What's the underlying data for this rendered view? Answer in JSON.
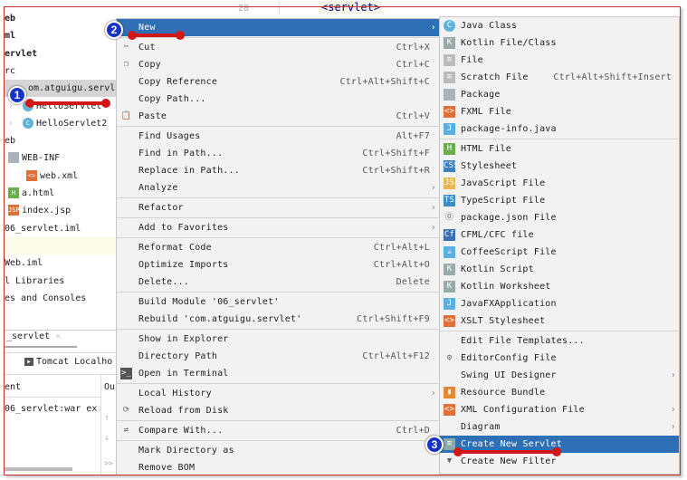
{
  "left_panel": {
    "tree": [
      {
        "label": "eb",
        "bold": true
      },
      {
        "label": "ml",
        "bold": true
      },
      {
        "label": "ervlet",
        "bold": true
      },
      {
        "label": "rc"
      },
      {
        "label": "om.atguigu.servl",
        "selected": true
      },
      {
        "label": "HelloServlet",
        "icon": "class-icon"
      },
      {
        "label": "HelloServlet2",
        "icon": "class-icon"
      },
      {
        "label": "eb"
      },
      {
        "label": "WEB-INF",
        "icon": "folder-icon"
      },
      {
        "label": "web.xml",
        "icon": "xml-file-icon"
      },
      {
        "label": "a.html",
        "icon": "html-file-icon"
      },
      {
        "label": "index.jsp",
        "icon": "jsp-file-icon"
      },
      {
        "label": "06_servlet.iml"
      },
      {
        "label": ""
      },
      {
        "label": "Web.iml"
      },
      {
        "label": "l Libraries"
      },
      {
        "label": "es and Consoles"
      }
    ],
    "run_tab": "_servlet",
    "tomcat_label": "Tomcat Localho",
    "col_header": "ent",
    "col_header2": "Ou",
    "deploy_item": "06_servlet:war ex",
    "more": ">>"
  },
  "editor": {
    "line_number": "28",
    "code": "<servlet>"
  },
  "context_menu": {
    "groups": [
      [
        {
          "label": "New",
          "arrow": true,
          "highlight": true
        }
      ],
      [
        {
          "label": "Cut",
          "shortcut": "Ctrl+X",
          "icon": "cut-icon"
        },
        {
          "label": "Copy",
          "shortcut": "Ctrl+C",
          "icon": "copy-icon"
        },
        {
          "label": "Copy Reference",
          "shortcut": "Ctrl+Alt+Shift+C"
        },
        {
          "label": "Copy Path...",
          "shortcut": ""
        },
        {
          "label": "Paste",
          "shortcut": "Ctrl+V",
          "icon": "paste-icon"
        }
      ],
      [
        {
          "label": "Find Usages",
          "shortcut": "Alt+F7"
        },
        {
          "label": "Find in Path...",
          "shortcut": "Ctrl+Shift+F"
        },
        {
          "label": "Replace in Path...",
          "shortcut": "Ctrl+Shift+R"
        },
        {
          "label": "Analyze",
          "arrow": true
        }
      ],
      [
        {
          "label": "Refactor",
          "arrow": true
        }
      ],
      [
        {
          "label": "Add to Favorites",
          "arrow": true
        }
      ],
      [
        {
          "label": "Reformat Code",
          "shortcut": "Ctrl+Alt+L"
        },
        {
          "label": "Optimize Imports",
          "shortcut": "Ctrl+Alt+O"
        },
        {
          "label": "Delete...",
          "shortcut": "Delete"
        }
      ],
      [
        {
          "label": "Build Module '06_servlet'"
        },
        {
          "label": "Rebuild 'com.atguigu.servlet'",
          "shortcut": "Ctrl+Shift+F9"
        }
      ],
      [
        {
          "label": "Show in Explorer"
        },
        {
          "label": "Directory Path",
          "shortcut": "Ctrl+Alt+F12"
        },
        {
          "label": "Open in Terminal",
          "icon": "terminal-icon"
        }
      ],
      [
        {
          "label": "Local History",
          "arrow": true
        },
        {
          "label": "Reload from Disk",
          "icon": "reload-icon"
        }
      ],
      [
        {
          "label": "Compare With...",
          "shortcut": "Ctrl+D",
          "icon": "compare-icon"
        }
      ],
      [
        {
          "label": "Mark Directory as"
        },
        {
          "label": "Remove BOM"
        }
      ]
    ]
  },
  "new_submenu": {
    "groups": [
      [
        {
          "label": "Java Class",
          "icon": "java-class-icon"
        },
        {
          "label": "Kotlin File/Class",
          "icon": "kotlin-icon"
        },
        {
          "label": "File",
          "icon": "file-icon"
        },
        {
          "label": "Scratch File",
          "shortcut": "Ctrl+Alt+Shift+Insert",
          "icon": "scratch-file-icon"
        },
        {
          "label": "Package",
          "icon": "package-icon"
        },
        {
          "label": "FXML File",
          "icon": "fxml-icon"
        },
        {
          "label": "package-info.java",
          "icon": "java-file-icon"
        }
      ],
      [
        {
          "label": "HTML File",
          "icon": "html-icon"
        },
        {
          "label": "Stylesheet",
          "icon": "css-icon"
        },
        {
          "label": "JavaScript File",
          "icon": "js-icon"
        },
        {
          "label": "TypeScript File",
          "icon": "ts-icon"
        },
        {
          "label": "package.json File",
          "icon": "nodejs-icon"
        },
        {
          "label": "CFML/CFC file",
          "icon": "cfml-icon"
        },
        {
          "label": "CoffeeScript File",
          "icon": "coffeescript-icon"
        },
        {
          "label": "Kotlin Script",
          "icon": "kotlin-script-icon"
        },
        {
          "label": "Kotlin Worksheet",
          "icon": "kotlin-worksheet-icon"
        },
        {
          "label": "JavaFXApplication",
          "icon": "javafx-icon"
        },
        {
          "label": "XSLT Stylesheet",
          "icon": "xslt-icon"
        }
      ],
      [
        {
          "label": "Edit File Templates..."
        },
        {
          "label": "EditorConfig File",
          "icon": "gear-icon"
        },
        {
          "label": "Swing UI Designer",
          "arrow": true
        },
        {
          "label": "Resource Bundle",
          "icon": "resource-bundle-icon"
        },
        {
          "label": "XML Configuration File",
          "arrow": true,
          "icon": "xml-config-icon"
        },
        {
          "label": "Diagram",
          "arrow": true
        },
        {
          "label": "Create New Servlet",
          "highlight": true,
          "icon": "servlet-icon"
        },
        {
          "label": "Create New Filter",
          "icon": "filter-icon"
        }
      ]
    ]
  },
  "annotations": {
    "step1": "1",
    "step2": "2",
    "step3": "3"
  },
  "colors": {
    "highlight": "#2f6fb5",
    "annotation_red": "#d01818",
    "badge_blue": "#1633c8"
  }
}
